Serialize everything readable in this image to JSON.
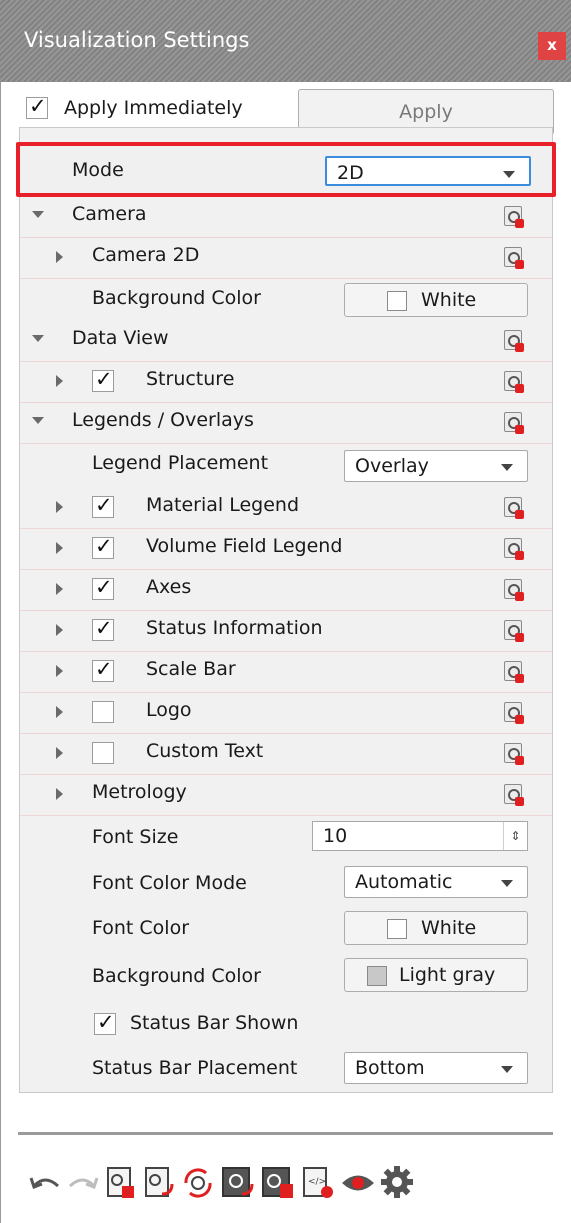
{
  "window": {
    "title": "Visualization Settings",
    "close_label": "x"
  },
  "top": {
    "apply_immediately_label": "Apply Immediately",
    "apply_immediately_checked": true,
    "apply_button_label": "Apply"
  },
  "mode": {
    "label": "Mode",
    "value": "2D"
  },
  "camera": {
    "label": "Camera",
    "camera2d_label": "Camera 2D",
    "background_color_label": "Background Color",
    "background_color_value": "White"
  },
  "data_view": {
    "label": "Data View",
    "structure_label": "Structure",
    "structure_checked": true
  },
  "legends": {
    "label": "Legends / Overlays",
    "placement_label": "Legend Placement",
    "placement_value": "Overlay",
    "items": [
      {
        "label": "Material Legend",
        "checked": true
      },
      {
        "label": "Volume Field Legend",
        "checked": true
      },
      {
        "label": "Axes",
        "checked": true
      },
      {
        "label": "Status Information",
        "checked": true
      },
      {
        "label": "Scale Bar",
        "checked": true
      },
      {
        "label": "Logo",
        "checked": false
      },
      {
        "label": "Custom Text",
        "checked": false
      }
    ],
    "metrology_label": "Metrology",
    "font_size_label": "Font Size",
    "font_size_value": "10",
    "font_color_mode_label": "Font Color Mode",
    "font_color_mode_value": "Automatic",
    "font_color_label": "Font Color",
    "font_color_value": "White",
    "background_color_label": "Background Color",
    "background_color_value": "Light gray",
    "status_bar_shown_label": "Status Bar Shown",
    "status_bar_shown_checked": true,
    "status_bar_placement_label": "Status Bar Placement",
    "status_bar_placement_value": "Bottom"
  },
  "colors": {
    "highlight": "#e8202a",
    "focus": "#3c8dde",
    "close": "#e04343",
    "white_swatch": "#ffffff",
    "lightgray_swatch": "#c8c8c8"
  },
  "toolbar_icons": [
    "undo-icon",
    "redo-icon",
    "reset-settings-icon",
    "reset-page-icon",
    "refresh-icon",
    "save-settings-icon",
    "load-settings-icon",
    "export-icon",
    "preview-icon",
    "gear-icon"
  ]
}
